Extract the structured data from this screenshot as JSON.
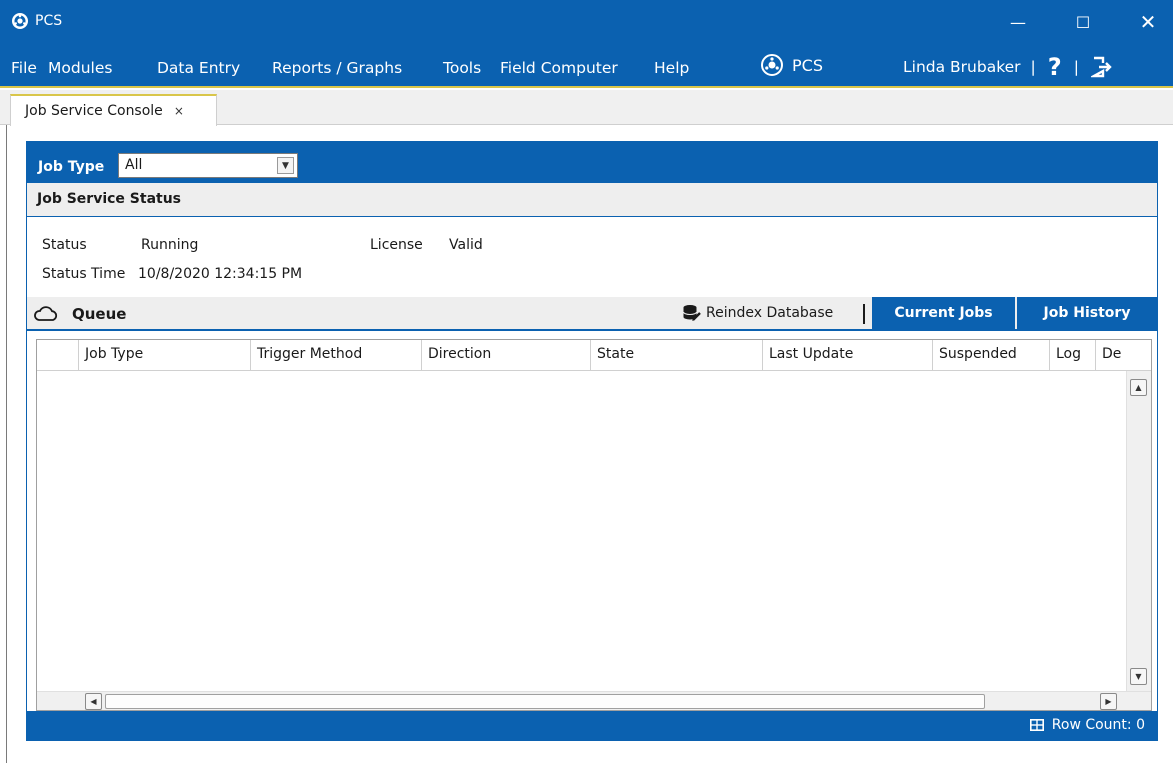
{
  "window": {
    "title": "PCS",
    "minimize": "—",
    "maximize": "☐",
    "close": "✕"
  },
  "menu": {
    "items": [
      "File",
      "Modules",
      "Data Entry",
      "Reports / Graphs",
      "Tools",
      "Field Computer",
      "Help"
    ],
    "brand": "PCS",
    "user": "Linda Brubaker",
    "separator": "|",
    "help": "?"
  },
  "tabs": {
    "active": {
      "label": "Job Service Console",
      "close": "×"
    }
  },
  "job_type": {
    "label": "Job Type",
    "selected": "All"
  },
  "status_section": {
    "title": "Job Service Status",
    "status_label": "Status",
    "status_value": "Running",
    "license_label": "License",
    "license_value": "Valid",
    "time_label": "Status Time",
    "time_value": "10/8/2020 12:34:15 PM"
  },
  "queue": {
    "title": "Queue",
    "reindex": "Reindex Database",
    "current_jobs": "Current Jobs",
    "job_history": "Job History"
  },
  "grid": {
    "columns": [
      "",
      "Job Type",
      "Trigger Method",
      "Direction",
      "State",
      "Last Update",
      "Suspended",
      "Log",
      "De"
    ],
    "rows": []
  },
  "footer": {
    "row_count": "Row Count: 0"
  },
  "colors": {
    "primary": "#0b61b0",
    "accent": "#d9c64a",
    "panel_gray": "#eeeeee"
  }
}
